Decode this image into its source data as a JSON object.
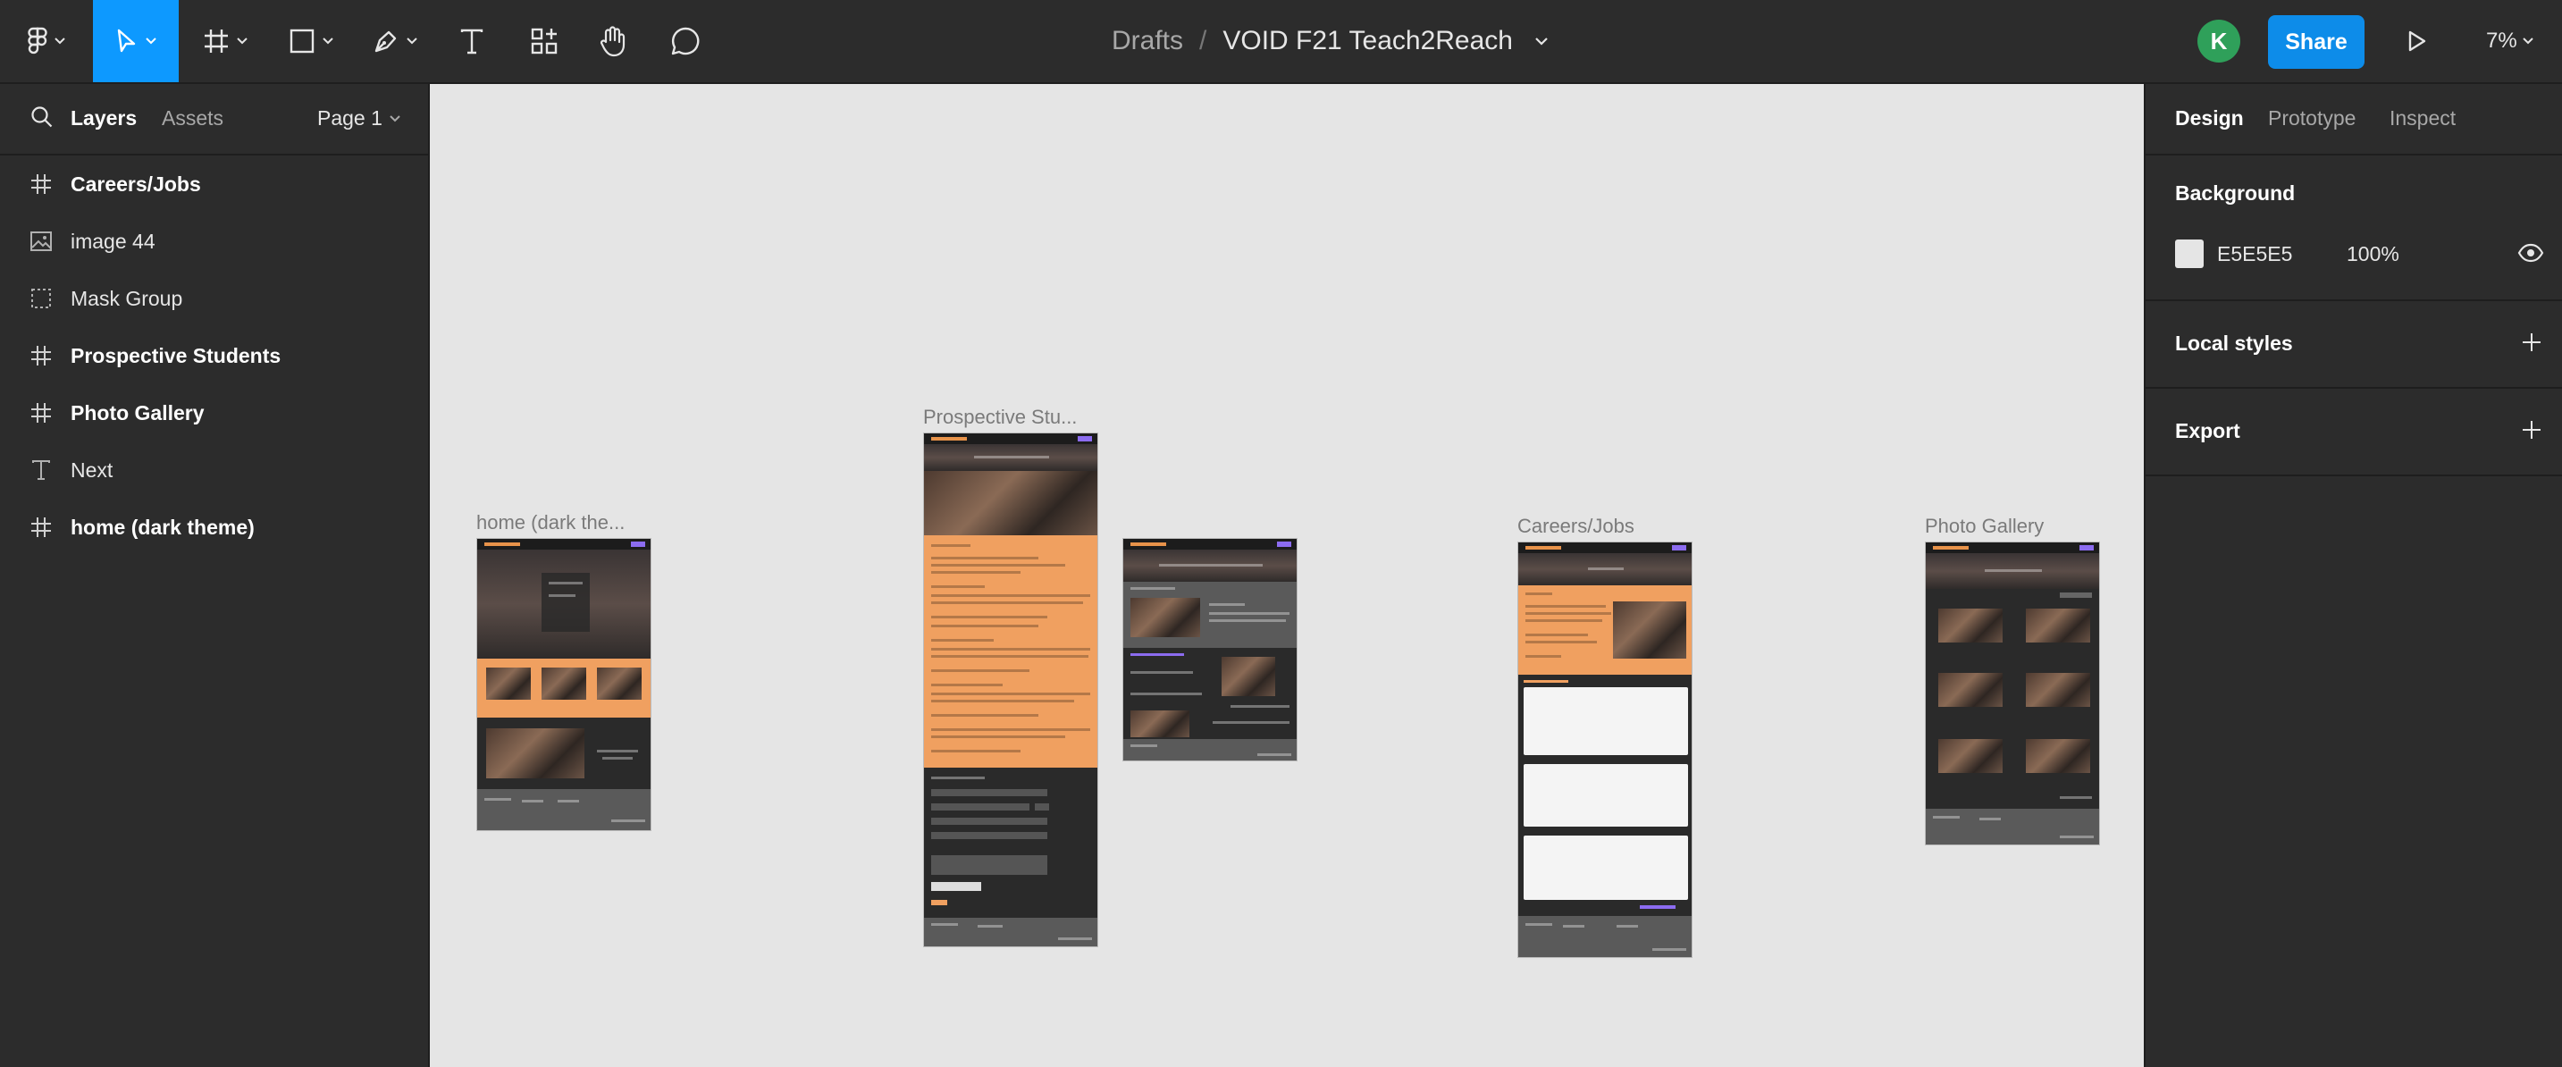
{
  "toolbar": {
    "breadcrumb_root": "Drafts",
    "separator": "/",
    "file_name": "VOID F21 Teach2Reach",
    "avatar_initial": "K",
    "share_label": "Share",
    "zoom": "7%",
    "accent_color": "#0d99ff"
  },
  "left_panel": {
    "tab_layers": "Layers",
    "tab_assets": "Assets",
    "page": "Page 1",
    "layers": [
      {
        "name": "Careers/Jobs",
        "icon": "frame-icon"
      },
      {
        "name": "image 44",
        "icon": "image-icon"
      },
      {
        "name": "Mask Group",
        "icon": "mask-group-icon"
      },
      {
        "name": "Prospective Students",
        "icon": "frame-icon"
      },
      {
        "name": "Photo Gallery",
        "icon": "frame-icon"
      },
      {
        "name": "Next",
        "icon": "text-icon"
      },
      {
        "name": "home (dark theme)",
        "icon": "frame-icon"
      }
    ]
  },
  "canvas": {
    "background": "#E5E5E5",
    "frames": {
      "home": "home (dark the...",
      "prospective": "Prospective Stu...",
      "careers": "Careers/Jobs",
      "gallery": "Photo Gallery"
    }
  },
  "right_panel": {
    "tab_design": "Design",
    "tab_prototype": "Prototype",
    "tab_inspect": "Inspect",
    "background_title": "Background",
    "background_hex": "E5E5E5",
    "background_opacity": "100%",
    "local_styles": "Local styles",
    "export": "Export"
  }
}
